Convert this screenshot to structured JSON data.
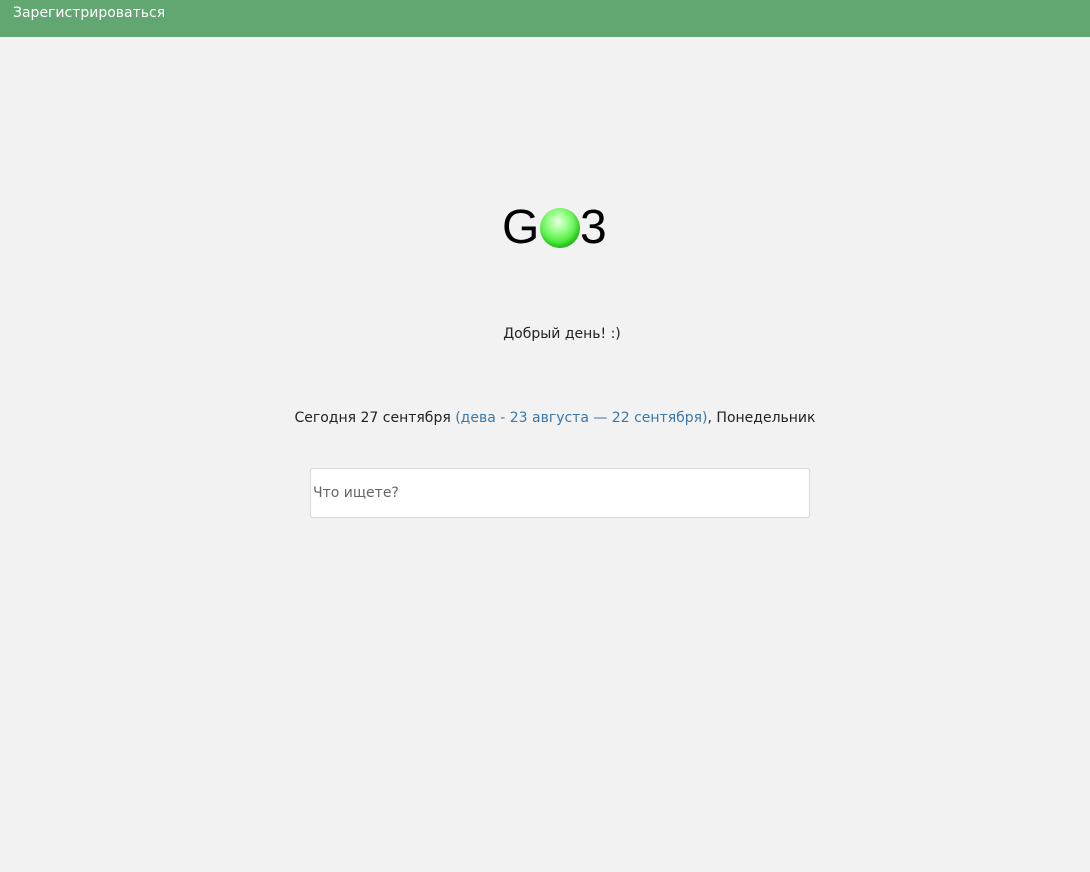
{
  "header": {
    "register_label": "Зарегистрироваться",
    "background_color": "#62a672"
  },
  "logo": {
    "letter_left": "G",
    "letter_right": "3",
    "ball_color": "#40e82f"
  },
  "greeting": "Добрый день! :)",
  "date": {
    "prefix": "Сегодня 27 сентября ",
    "zodiac": "(дева - 23 августа — 22 сентября)",
    "suffix": ", Понедельник",
    "zodiac_color": "#3a78a8"
  },
  "search": {
    "placeholder": "Что ищете?",
    "value": ""
  }
}
